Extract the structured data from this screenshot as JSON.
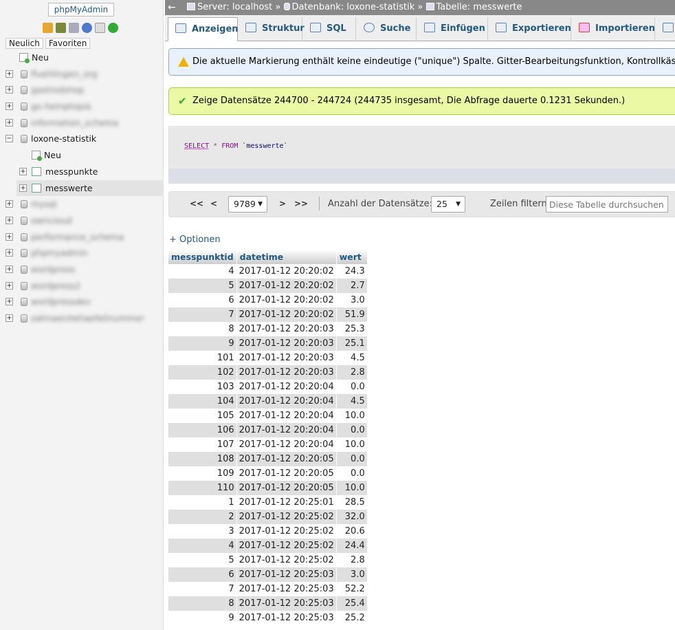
{
  "nav": {
    "logo_alt": "phpMyAdmin",
    "tabs": [
      "Neulich",
      "Favoriten"
    ],
    "icons": [
      "home-icon",
      "exit-icon",
      "sql-query-icon",
      "docs-icon",
      "copy-icon",
      "reload-icon"
    ],
    "new_label": "Neu",
    "databases_before": [
      "fluehlingen_org",
      "gastrodshop",
      "go-hemptopia",
      "information_schema"
    ],
    "active_db": {
      "name": "loxone-statistik",
      "new_label": "Neu",
      "tables": [
        "messpunkte",
        "messwerte"
      ]
    },
    "databases_after": [
      "mysql",
      "owncloud",
      "performance_schema",
      "phpmyadmin",
      "wordpress",
      "wordpress2",
      "wordpressdev",
      "zahnaerztehaefelinummer"
    ]
  },
  "breadcrumb": {
    "back": "←",
    "server": "Server: localhost",
    "database": "Datenbank: loxone-statistik",
    "table": "Tabelle: messwerte",
    "sep": "»"
  },
  "tabs": [
    "Anzeigen",
    "Struktur",
    "SQL",
    "Suche",
    "Einfügen",
    "Exportieren",
    "Importieren"
  ],
  "warning": "Die aktuelle Markierung enthält keine eindeutige (\"unique\") Spalte. Gitter-Bearbeitungsfunktion, Kontrollkästchen, Bearbeiten",
  "success": "Zeige Datensätze 244700 - 244724 (244735 insgesamt, Die Abfrage dauerte 0.1231 Sekunden.)",
  "sql": {
    "select": "SELECT",
    "star": "*",
    "from": "FROM",
    "table": "`messwerte`"
  },
  "pager": {
    "first": "<<",
    "prev": "<",
    "page": "9789",
    "next": ">",
    "last": ">>",
    "rows_label": "Anzahl der Datensätze:",
    "rows_value": "25",
    "filter_label": "Zeilen filtern:",
    "filter_placeholder": "Diese Tabelle durchsuchen"
  },
  "options_link": "+ Optionen",
  "table": {
    "columns": [
      "messpunktid",
      "datetime",
      "wert"
    ],
    "rows": [
      [
        "4",
        "2017-01-12 20:20:02",
        "24.3"
      ],
      [
        "5",
        "2017-01-12 20:20:02",
        "2.7"
      ],
      [
        "6",
        "2017-01-12 20:20:02",
        "3.0"
      ],
      [
        "7",
        "2017-01-12 20:20:02",
        "51.9"
      ],
      [
        "8",
        "2017-01-12 20:20:03",
        "25.3"
      ],
      [
        "9",
        "2017-01-12 20:20:03",
        "25.1"
      ],
      [
        "101",
        "2017-01-12 20:20:03",
        "4.5"
      ],
      [
        "102",
        "2017-01-12 20:20:03",
        "2.8"
      ],
      [
        "103",
        "2017-01-12 20:20:04",
        "0.0"
      ],
      [
        "104",
        "2017-01-12 20:20:04",
        "4.5"
      ],
      [
        "105",
        "2017-01-12 20:20:04",
        "10.0"
      ],
      [
        "106",
        "2017-01-12 20:20:04",
        "0.0"
      ],
      [
        "107",
        "2017-01-12 20:20:04",
        "10.0"
      ],
      [
        "108",
        "2017-01-12 20:20:05",
        "0.0"
      ],
      [
        "109",
        "2017-01-12 20:20:05",
        "0.0"
      ],
      [
        "110",
        "2017-01-12 20:20:05",
        "10.0"
      ],
      [
        "1",
        "2017-01-12 20:25:01",
        "28.5"
      ],
      [
        "2",
        "2017-01-12 20:25:02",
        "32.0"
      ],
      [
        "3",
        "2017-01-12 20:25:02",
        "20.6"
      ],
      [
        "4",
        "2017-01-12 20:25:02",
        "24.4"
      ],
      [
        "5",
        "2017-01-12 20:25:02",
        "2.8"
      ],
      [
        "6",
        "2017-01-12 20:25:03",
        "3.0"
      ],
      [
        "7",
        "2017-01-12 20:25:03",
        "52.2"
      ],
      [
        "8",
        "2017-01-12 20:25:03",
        "25.4"
      ],
      [
        "9",
        "2017-01-12 20:25:03",
        "25.2"
      ]
    ]
  },
  "colors": {
    "accent": "#235a81",
    "topbar": "#888888",
    "success_bg": "#ebf8a4",
    "warning_bg": "#e9f2fc"
  }
}
